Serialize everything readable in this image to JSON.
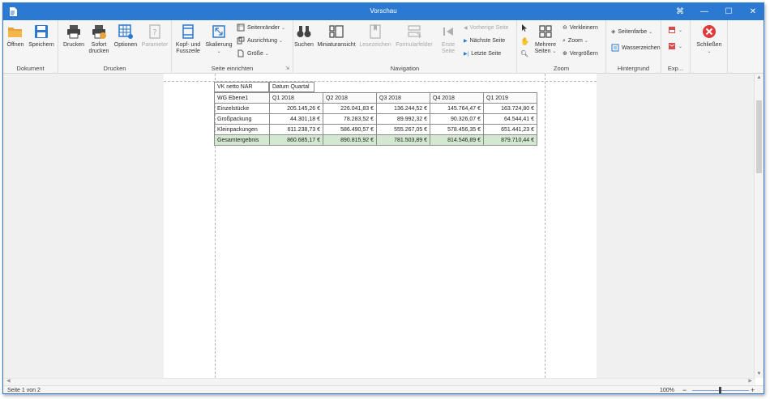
{
  "window": {
    "title": "Vorschau",
    "controls": [
      "⌘",
      "—",
      "☐",
      "✕"
    ]
  },
  "ribbon": {
    "groups": {
      "dokument": "Dokument",
      "drucken": "Drucken",
      "seite": "Seite einrichten",
      "navigation": "Navigation",
      "zoom": "Zoom",
      "hintergrund": "Hintergrund",
      "export": "Exp..."
    },
    "buttons": {
      "oeffnen": "Öffnen",
      "speichern": "Speichern",
      "drucken": "Drucken",
      "sofort1": "Sofort",
      "sofort2": "drucken",
      "optionen": "Optionen",
      "parameter": "Parameter",
      "kopf1": "Kopf- und",
      "kopf2": "Fusszeile",
      "skalierung": "Skalierung",
      "seitenraender": "Seitenränder",
      "ausrichtung": "Ausrichtung",
      "groesse": "Größe",
      "suchen": "Suchen",
      "miniatur": "Miniaturansicht",
      "lesezeichen": "Lesezeichen",
      "formular": "Formularfelder",
      "erste1": "Erste",
      "erste2": "Seite",
      "vorherige": "Vorherige Seite",
      "naechste": "Nächste Seite",
      "letzte": "Letzte Seite",
      "mehrere1": "Mehrere",
      "mehrere2": "Seiten",
      "verkleinern": "Verkleinern",
      "zoom": "Zoom",
      "vergroessern": "Vergrößern",
      "seitenfarbe": "Seitenfarbe",
      "wasserzeichen": "Wasserzeichen",
      "schliessen": "Schließen"
    }
  },
  "report": {
    "field_measure": "VK netto NAR",
    "field_column": "Datum Quartal",
    "row_header": "WG Ebene1",
    "columns": [
      "Q1 2018",
      "Q2 2018",
      "Q3 2018",
      "Q4 2018",
      "Q1 2019"
    ],
    "rows": [
      {
        "label": "Einzelstücke",
        "values": [
          "205.145,26 €",
          "226.041,83 €",
          "136.244,52 €",
          "145.764,47 €",
          "163.724,80 €"
        ]
      },
      {
        "label": "Großpackung",
        "values": [
          "44.301,18 €",
          "78.283,52 €",
          "89.992,32 €",
          "90.326,07 €",
          "64.544,41 €"
        ]
      },
      {
        "label": "Kleinpackungen",
        "values": [
          "611.238,73 €",
          "586.490,57 €",
          "555.267,05 €",
          "578.456,35 €",
          "651.441,23 €"
        ]
      }
    ],
    "total": {
      "label": "Gesamtergebnis",
      "values": [
        "860.685,17 €",
        "890.815,92 €",
        "781.503,89 €",
        "814.546,89 €",
        "879.710,44 €"
      ]
    }
  },
  "status": {
    "page_info": "Seite 1 von 2",
    "zoom_level": "100%",
    "zoom_minus": "−",
    "zoom_plus": "+"
  }
}
